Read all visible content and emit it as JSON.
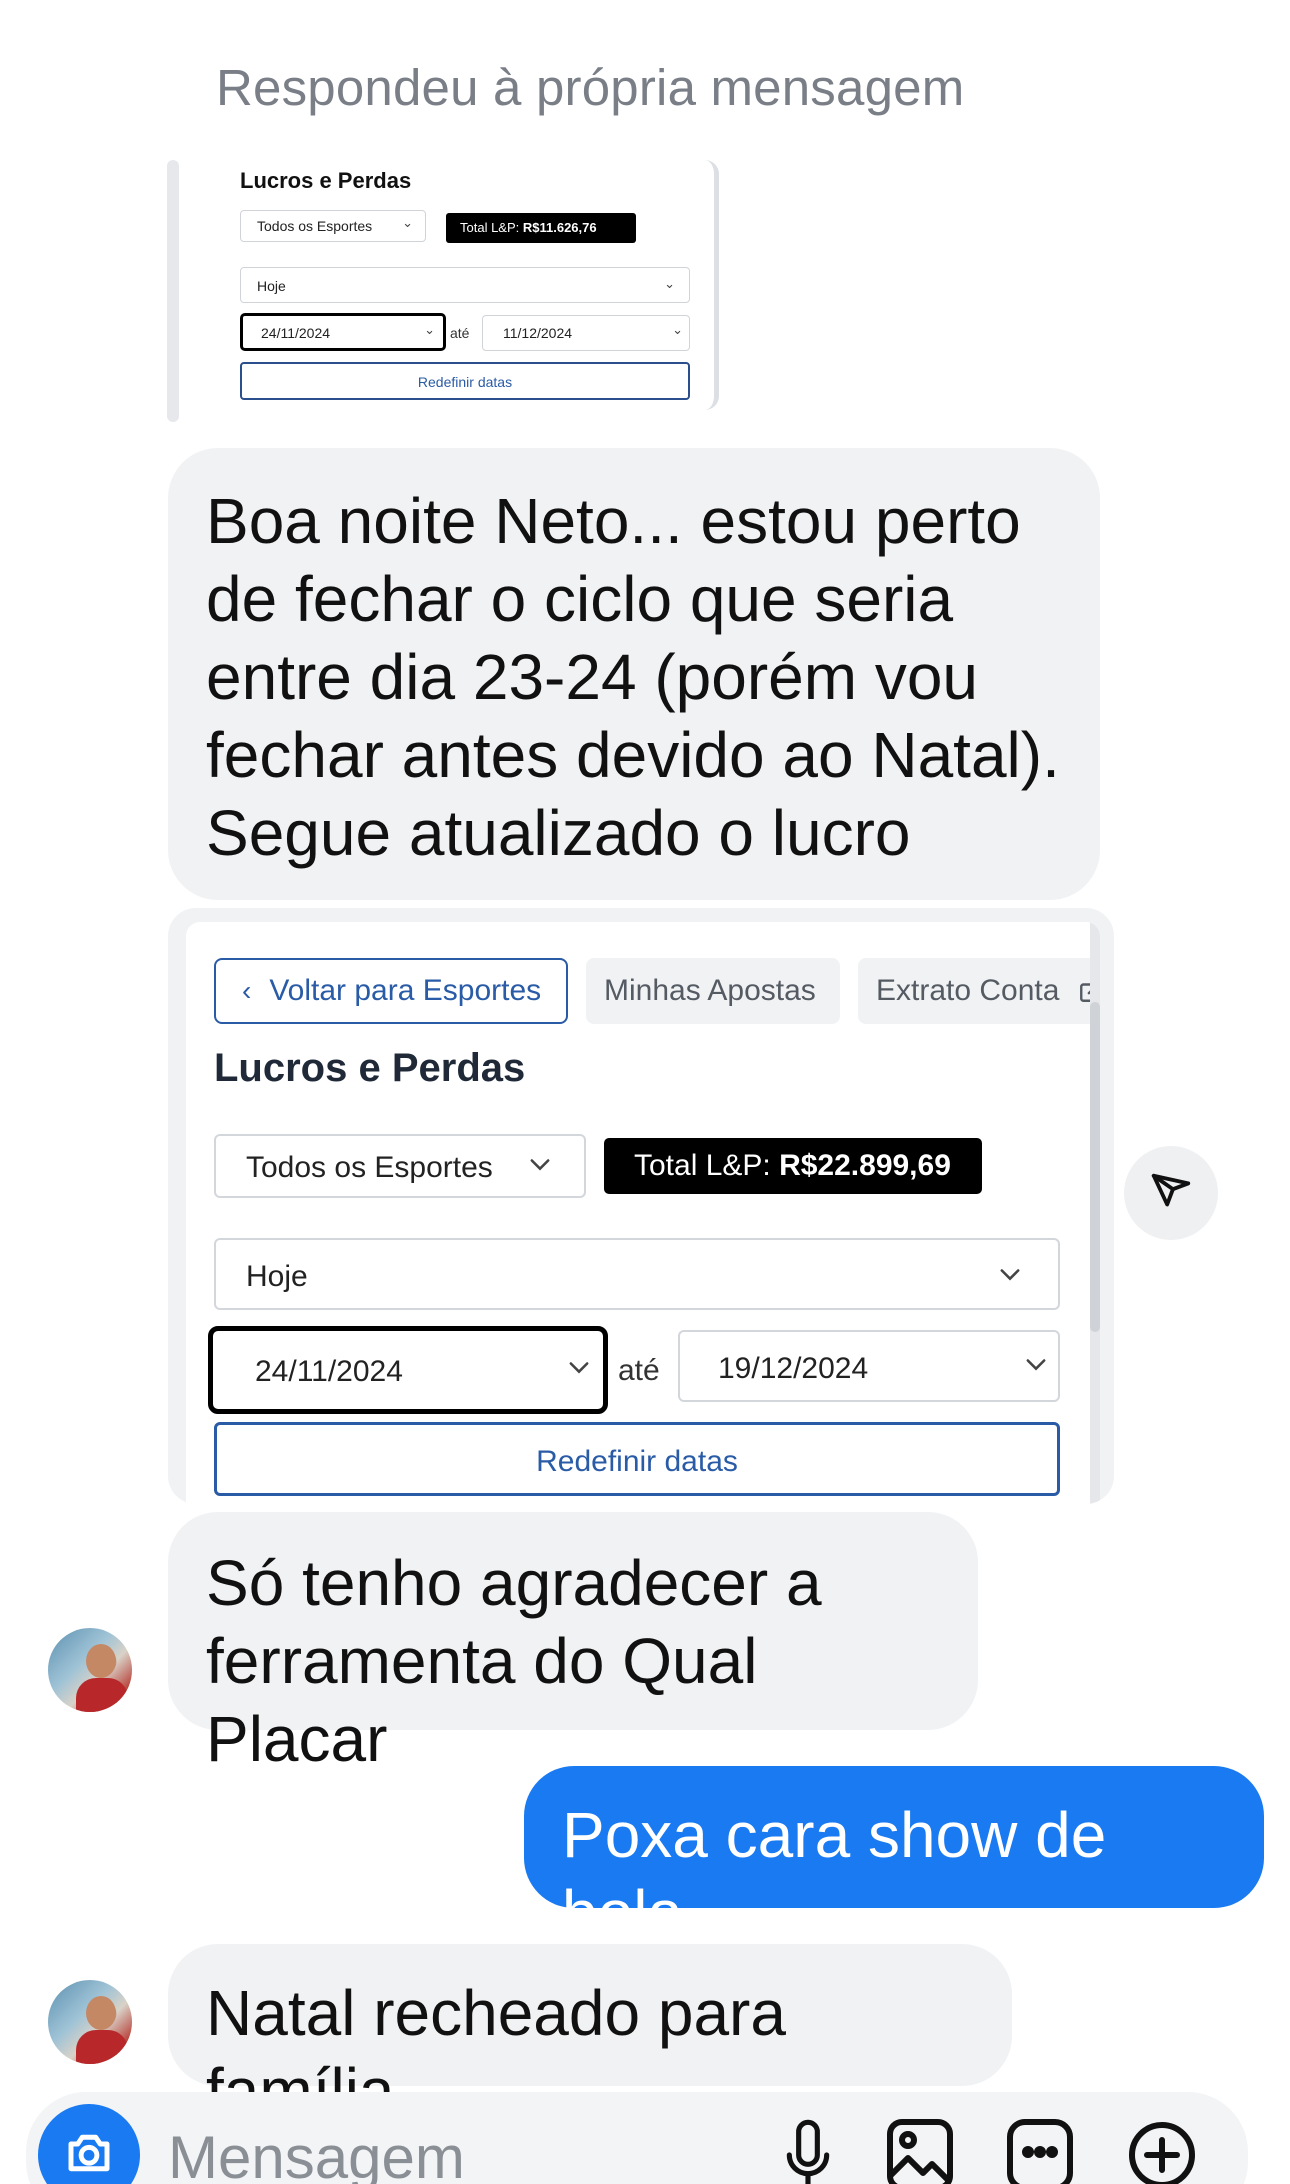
{
  "reply_note": "Respondeu à própria mensagem",
  "quoted_screenshot": {
    "title": "Lucros e Perdas",
    "sport_select": "Todos os Esportes",
    "total_label": "Total L&P: ",
    "total_value": "R$11.626,76",
    "period_select": "Hoje",
    "date_from": "24/11/2024",
    "until_label": "até",
    "date_to": "11/12/2024",
    "reset_button": "Redefinir datas"
  },
  "messages": {
    "msg1": "Boa noite Neto... estou perto de fechar o ciclo que seria entre dia 23-24 (porém vou fechar antes devido ao Natal). Segue atualizado o lucro",
    "msg3": "Só tenho agradecer a ferramenta do Qual Placar",
    "msg4": "Poxa cara show de bola",
    "msg5": "Natal recheado para família"
  },
  "screenshot": {
    "back_button": "Voltar para Esportes",
    "tab_bets": "Minhas Apostas",
    "tab_statement": "Extrato Conta",
    "title": "Lucros e Perdas",
    "sport_select": "Todos os Esportes",
    "total_label": "Total L&P: ",
    "total_value": "R$22.899,69",
    "period_select": "Hoje",
    "date_from": "24/11/2024",
    "until_label": "até",
    "date_to": "19/12/2024",
    "reset_button": "Redefinir datas"
  },
  "composer": {
    "placeholder": "Mensagem"
  },
  "colors": {
    "outgoing_bubble": "#1a7af2",
    "incoming_bubble": "#f1f2f4",
    "link_blue": "#2a5ba6"
  },
  "icons": [
    "share-icon",
    "camera-icon",
    "microphone-icon",
    "image-icon",
    "sticker-icon",
    "plus-icon",
    "chevron-left-icon",
    "chevron-down-icon",
    "external-link-icon"
  ]
}
